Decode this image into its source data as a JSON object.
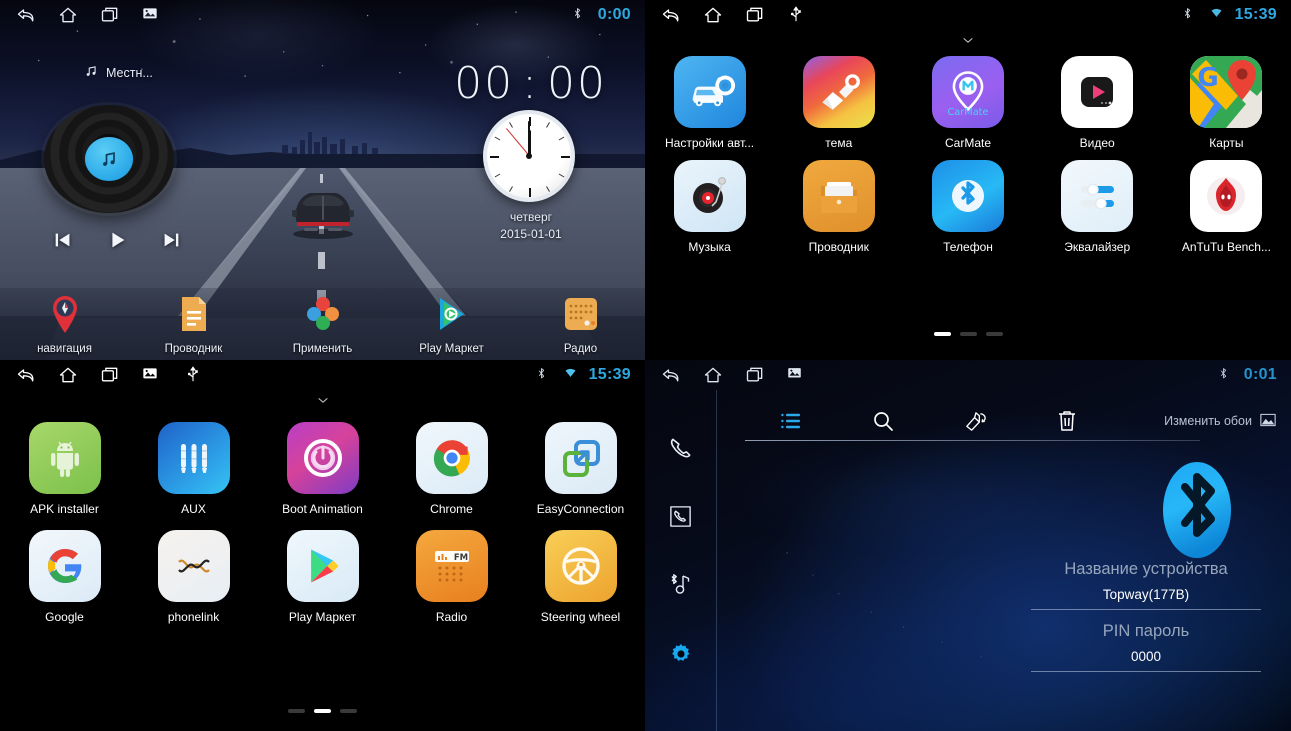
{
  "panels": {
    "home": {
      "name": "Car head unit home screen",
      "statusbar": {
        "icons": [
          "back-icon",
          "home-icon",
          "recents-icon",
          "gallery-icon"
        ],
        "bluetooth": "bluetooth-icon",
        "clock": "0:00"
      },
      "now_playing": {
        "icon": "music-note-icon",
        "label": "Местн..."
      },
      "big_clock": {
        "hours": "00",
        "separator": ":",
        "minutes": "00"
      },
      "media_controls": {
        "prev": "previous-track-icon",
        "play": "play-icon",
        "next": "next-track-icon"
      },
      "clock_widget": {
        "day": "четверг",
        "date": "2015-01-01"
      },
      "dock": [
        {
          "label": "навигация",
          "icon": "navigation-pin-icon"
        },
        {
          "label": "Проводник",
          "icon": "file-manager-icon"
        },
        {
          "label": "Применить",
          "icon": "apply-flower-icon"
        },
        {
          "label": "Play Маркет",
          "icon": "play-store-icon"
        },
        {
          "label": "Радио",
          "icon": "radio-icon"
        }
      ]
    },
    "drawer_page1": {
      "name": "App drawer page 1",
      "statusbar": {
        "icons": [
          "back-icon",
          "home-icon",
          "recents-icon",
          "usb-icon"
        ],
        "bluetooth": "bluetooth-icon",
        "wifi": "wifi-icon",
        "clock": "15:39"
      },
      "pulldown": "chevron-down-icon",
      "apps": [
        {
          "label": "Настройки авт...",
          "icon": "car-settings-icon"
        },
        {
          "label": "тема",
          "icon": "theme-brush-icon"
        },
        {
          "label": "CarMate",
          "icon": "carmate-icon"
        },
        {
          "label": "Видео",
          "icon": "video-player-icon"
        },
        {
          "label": "Карты",
          "icon": "google-maps-icon"
        },
        {
          "label": "Музыка",
          "icon": "music-turntable-icon"
        },
        {
          "label": "Проводник",
          "icon": "file-manager-folder-icon"
        },
        {
          "label": "Телефон",
          "icon": "bluetooth-phone-icon"
        },
        {
          "label": "Эквалайзер",
          "icon": "equalizer-icon"
        },
        {
          "label": "AnTuTu Bench...",
          "icon": "antutu-icon"
        }
      ],
      "pager": {
        "count": 3,
        "active": 0
      }
    },
    "drawer_page2": {
      "name": "App drawer page 2",
      "statusbar": {
        "icons": [
          "back-icon",
          "home-icon",
          "recents-icon",
          "gallery-icon",
          "usb-icon"
        ],
        "bluetooth": "bluetooth-icon",
        "wifi": "wifi-icon",
        "clock": "15:39"
      },
      "pulldown": "chevron-down-icon",
      "apps": [
        {
          "label": "APK installer",
          "icon": "android-icon"
        },
        {
          "label": "AUX",
          "icon": "aux-jack-icon"
        },
        {
          "label": "Boot Animation",
          "icon": "power-icon"
        },
        {
          "label": "Chrome",
          "icon": "chrome-icon"
        },
        {
          "label": "EasyConnection",
          "icon": "easyconnection-icon"
        },
        {
          "label": "Google",
          "icon": "google-g-icon"
        },
        {
          "label": "phonelink",
          "icon": "phonelink-icon"
        },
        {
          "label": "Play Маркет",
          "icon": "play-store-icon"
        },
        {
          "label": "Radio",
          "icon": "fm-radio-icon"
        },
        {
          "label": "Steering wheel",
          "icon": "steering-wheel-icon"
        }
      ],
      "pager": {
        "count": 3,
        "active": 1
      }
    },
    "bluetooth": {
      "name": "Bluetooth settings screen",
      "statusbar": {
        "icons": [
          "back-icon",
          "home-icon",
          "recents-icon",
          "gallery-icon"
        ],
        "bluetooth": "bluetooth-icon",
        "clock": "0:01"
      },
      "sidebar": [
        {
          "icon": "dial-phone-icon",
          "active": false
        },
        {
          "icon": "contacts-phone-icon",
          "active": false
        },
        {
          "icon": "bluetooth-music-icon",
          "active": false
        },
        {
          "icon": "settings-gear-icon",
          "active": true
        }
      ],
      "toolbar": [
        {
          "icon": "list-icon"
        },
        {
          "icon": "search-icon"
        },
        {
          "icon": "sync-contacts-icon"
        },
        {
          "icon": "trash-icon"
        }
      ],
      "wallpaper_button": {
        "label": "Изменить обои",
        "icon": "image-icon"
      },
      "bluetooth_logo": "bluetooth-logo-icon",
      "fields": [
        {
          "label": "Название устройства",
          "value": "Topway(177B)"
        },
        {
          "label": "PIN пароль",
          "value": "0000"
        }
      ]
    }
  },
  "colors": {
    "accent_blue": "#2ea8e0",
    "bt_blue": "#17a9f0",
    "drawer_bg": "#000000"
  }
}
